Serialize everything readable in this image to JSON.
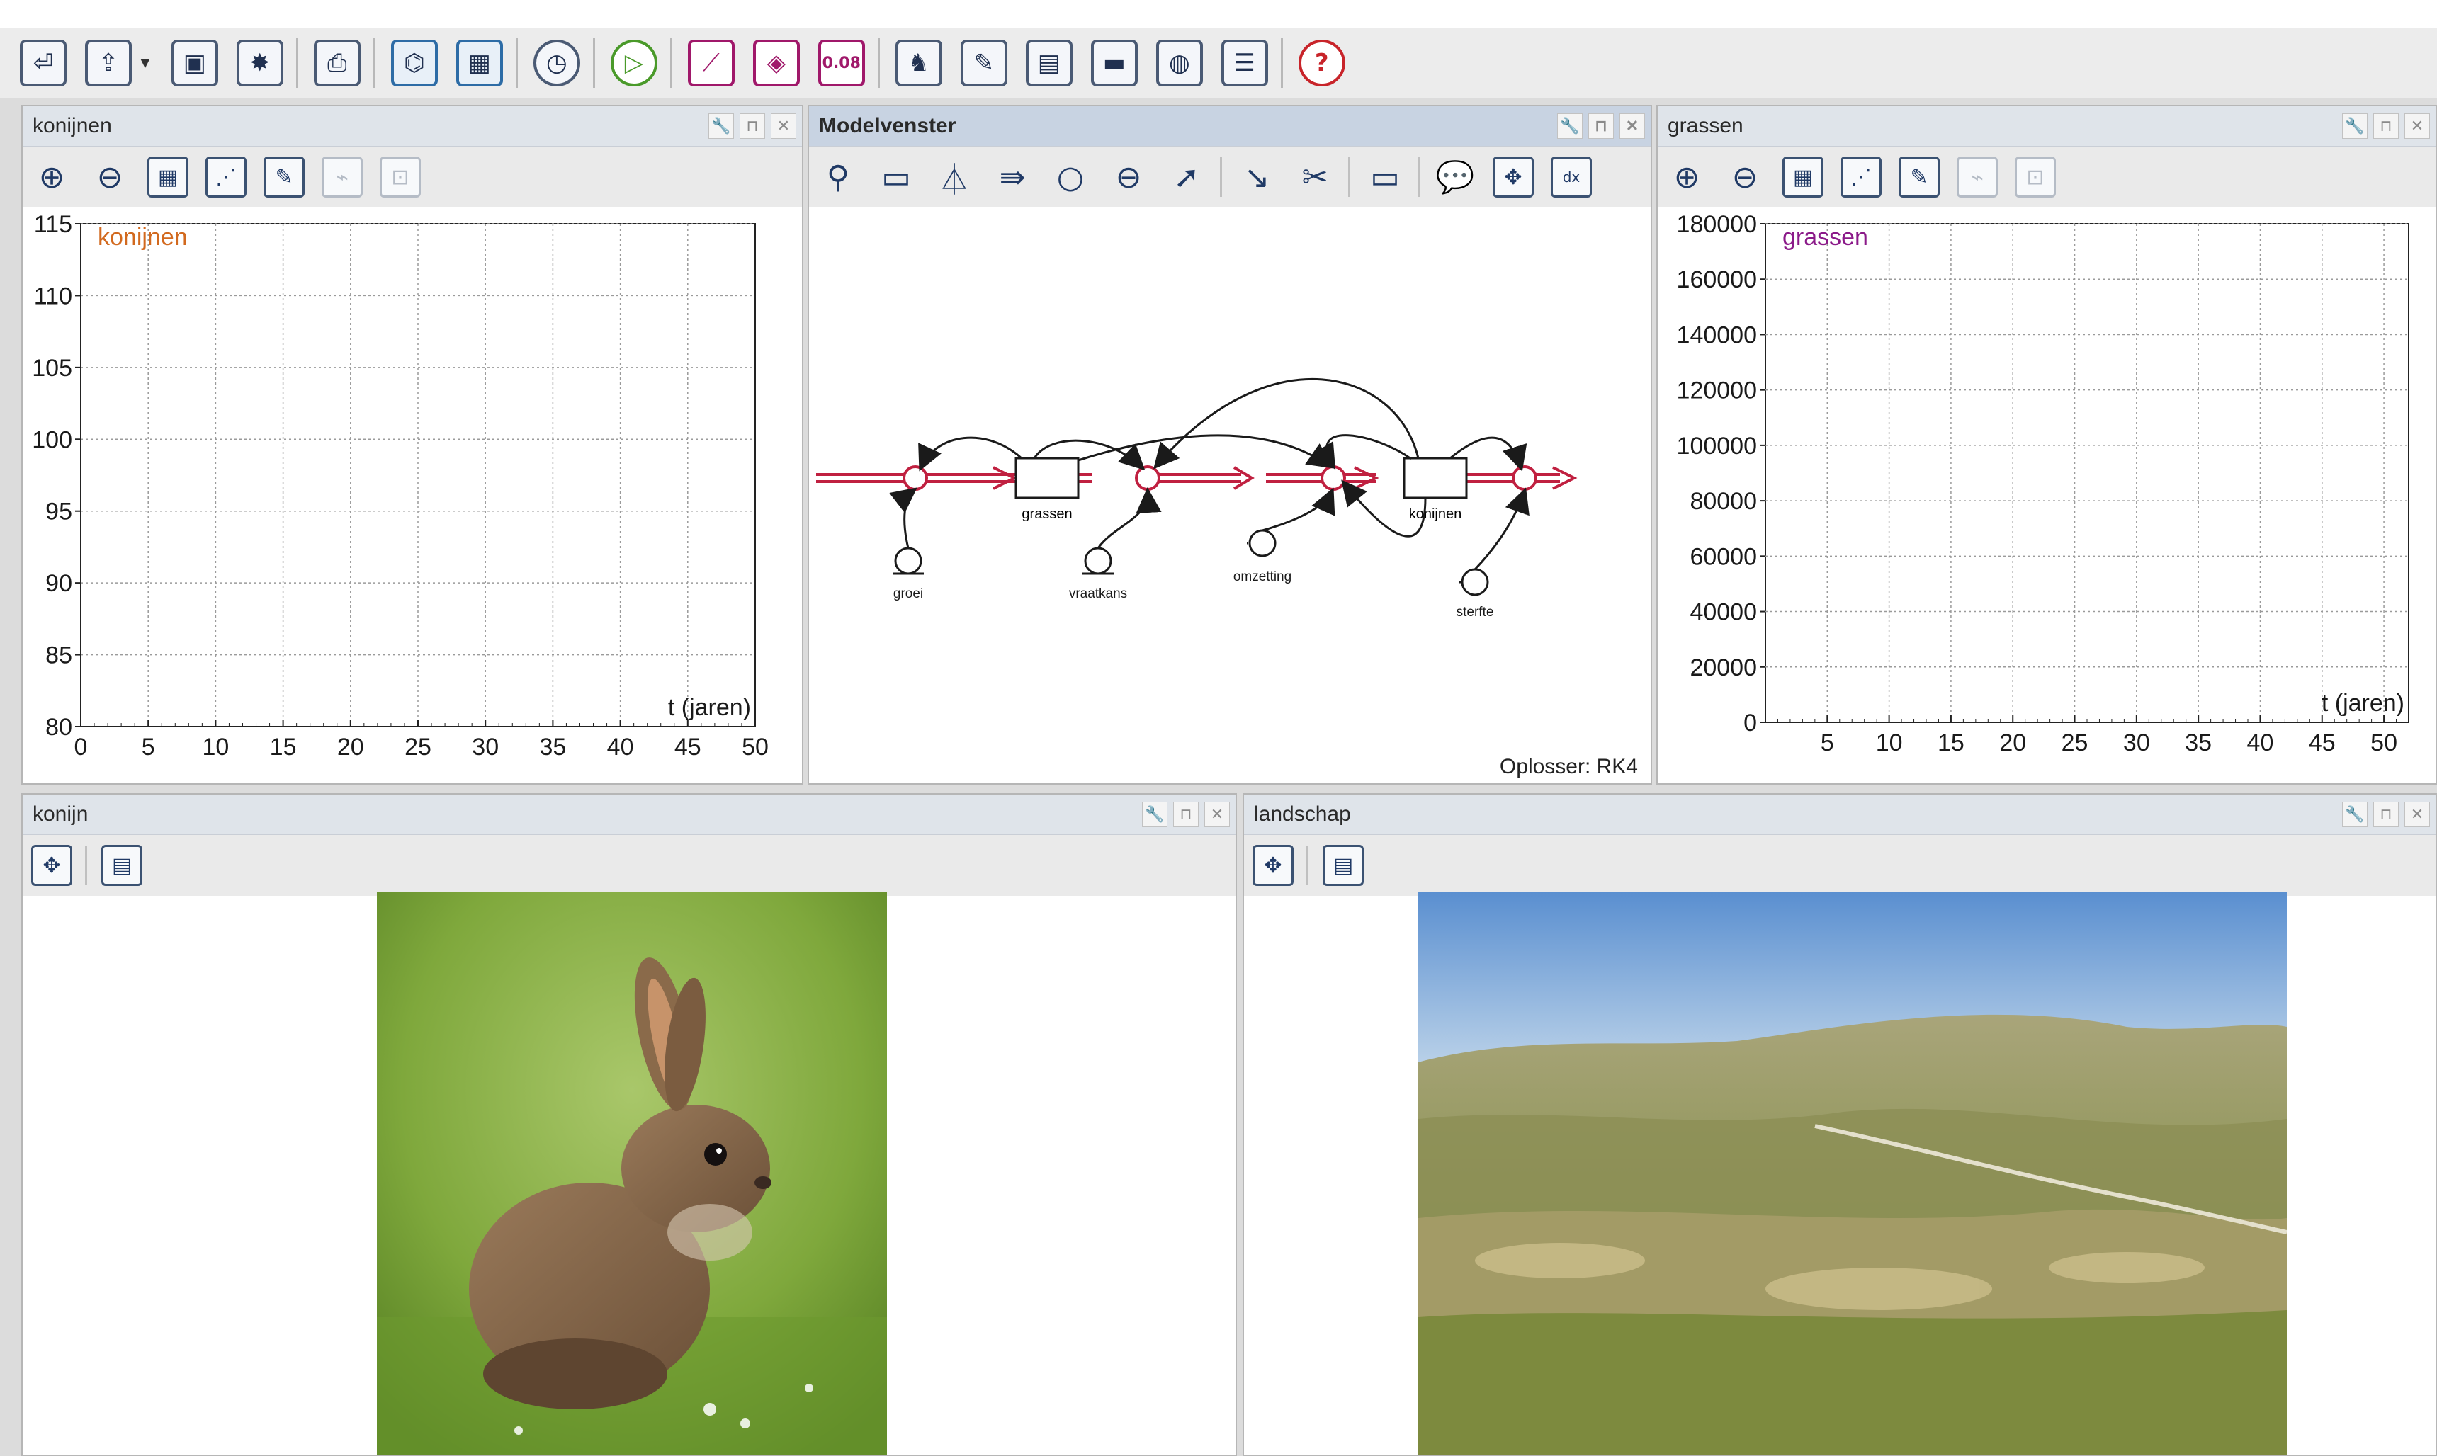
{
  "toolbar": {
    "items": [
      {
        "name": "exit-icon",
        "glyph": "⏎"
      },
      {
        "name": "open-icon",
        "glyph": "⇪"
      },
      {
        "name": "save-icon",
        "glyph": "▣"
      },
      {
        "name": "new-icon",
        "glyph": "✸"
      },
      {
        "name": "print-icon",
        "glyph": "⎙"
      },
      {
        "name": "model-icon",
        "glyph": "⌬"
      },
      {
        "name": "table-icon",
        "glyph": "▦"
      },
      {
        "name": "timer-icon",
        "glyph": "◷"
      },
      {
        "name": "run-icon",
        "glyph": "▷"
      },
      {
        "name": "graph-icon",
        "glyph": "⟋"
      },
      {
        "name": "diagram-icon",
        "glyph": "◈"
      },
      {
        "name": "value-icon",
        "glyph": "0.08"
      },
      {
        "name": "animation-icon",
        "glyph": "♞"
      },
      {
        "name": "notes-icon",
        "glyph": "✎"
      },
      {
        "name": "image-icon",
        "glyph": "▤"
      },
      {
        "name": "video-icon",
        "glyph": "▬"
      },
      {
        "name": "web-icon",
        "glyph": "◍"
      },
      {
        "name": "text-icon",
        "glyph": "☰"
      },
      {
        "name": "help-icon",
        "glyph": "?"
      }
    ]
  },
  "windows": {
    "konijnen_graph": {
      "title": "konijnen"
    },
    "model": {
      "title": "Modelvenster",
      "solver": "Oplosser: RK4"
    },
    "grassen_graph": {
      "title": "grassen"
    },
    "konijn_image": {
      "title": "konijn"
    },
    "landschap_image": {
      "title": "landschap"
    }
  },
  "colors": {
    "konijnen": "#d2691e",
    "grassen": "#8b1a89",
    "stock": "#8b1a1a",
    "flow": "#c02040"
  },
  "model": {
    "stocks": [
      "grassen",
      "konijnen"
    ],
    "parameters": [
      "groei",
      "vraatkans",
      "omzetting",
      "sterfte"
    ]
  },
  "chart_data": [
    {
      "type": "line",
      "series": [
        {
          "name": "konijnen",
          "values": []
        }
      ],
      "x": [],
      "xlabel": "t (jaren)",
      "ylabel": "",
      "xlim": [
        0,
        50
      ],
      "ylim": [
        80,
        115
      ],
      "xticks": [
        "0",
        "5",
        "10",
        "15",
        "20",
        "25",
        "30",
        "35",
        "40",
        "45",
        "50"
      ],
      "yticks": [
        "80",
        "85",
        "90",
        "95",
        "100",
        "105",
        "110",
        "115"
      ],
      "grid": true,
      "legend": "top-left"
    },
    {
      "type": "line",
      "series": [
        {
          "name": "grassen",
          "values": []
        }
      ],
      "x": [],
      "xlabel": "t (jaren)",
      "ylabel": "",
      "xlim": [
        0,
        52
      ],
      "ylim": [
        0,
        180000
      ],
      "xticks": [
        "5",
        "10",
        "15",
        "20",
        "25",
        "30",
        "35",
        "40",
        "45",
        "50"
      ],
      "yticks": [
        "0",
        "20000",
        "40000",
        "60000",
        "80000",
        "100000",
        "120000",
        "140000",
        "160000",
        "180000"
      ],
      "grid": true,
      "legend": "top-left"
    }
  ]
}
